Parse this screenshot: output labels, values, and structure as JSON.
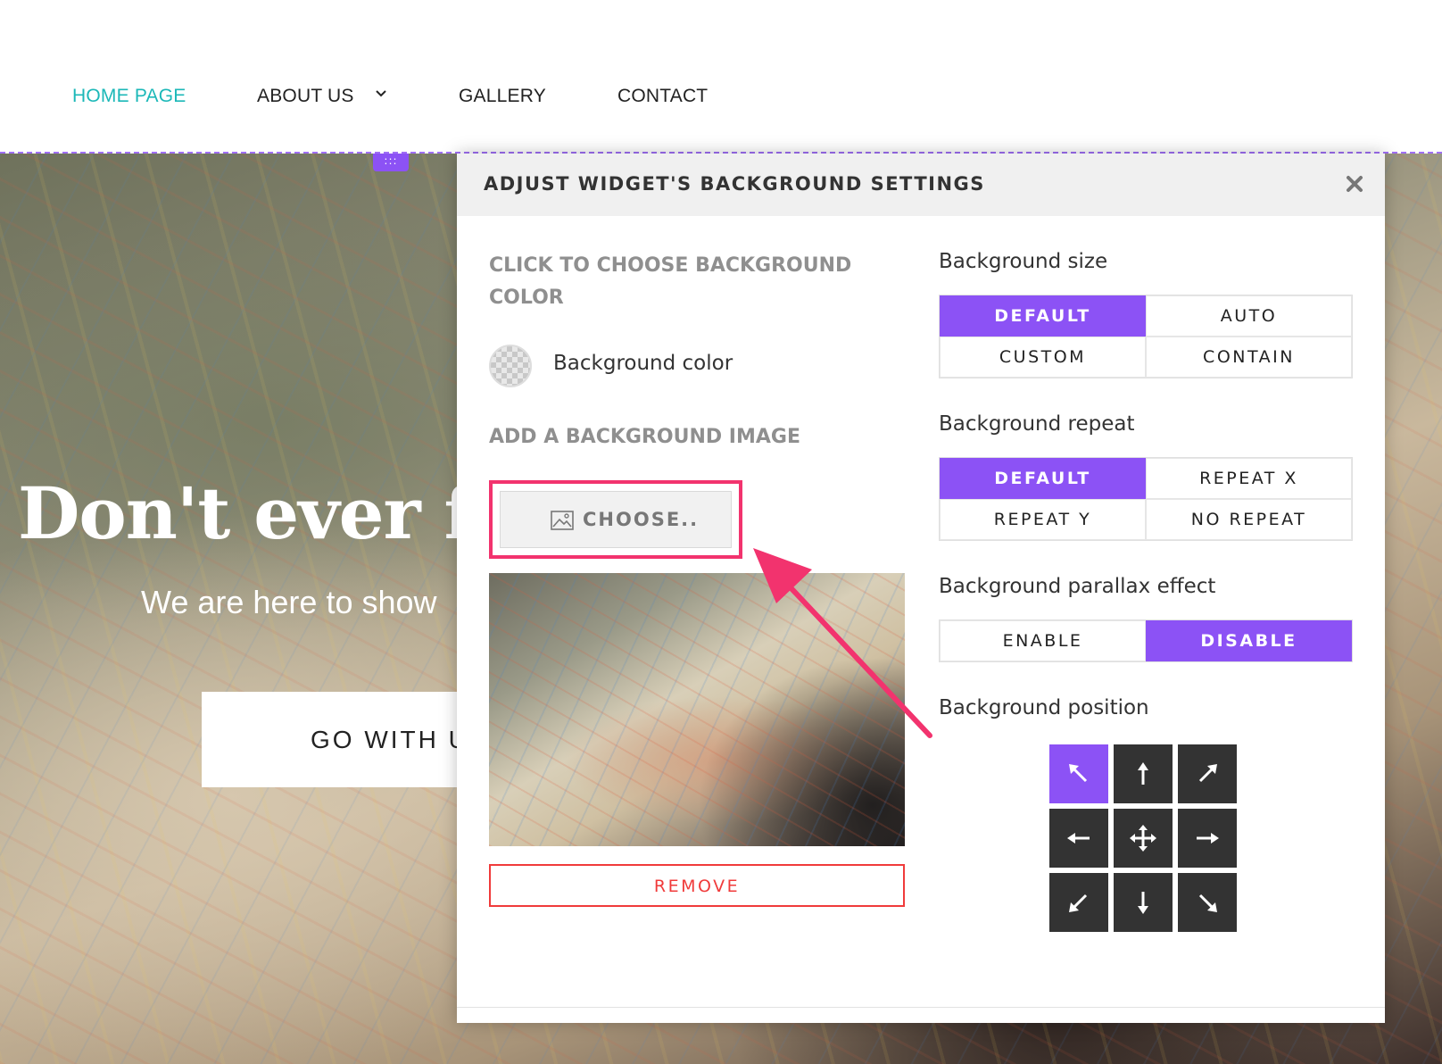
{
  "nav": {
    "items": [
      {
        "label": "HOME PAGE",
        "active": true
      },
      {
        "label": "ABOUT US",
        "has_dropdown": true
      },
      {
        "label": "GALLERY"
      },
      {
        "label": "CONTACT"
      }
    ]
  },
  "hero": {
    "title": "Don't ever f",
    "subtitle": "We are here to show",
    "button_label": "GO WITH U"
  },
  "modal": {
    "title": "ADJUST WIDGET'S BACKGROUND SETTINGS",
    "close_icon": "close-icon",
    "left": {
      "color_heading": "CLICK TO CHOOSE BACKGROUND COLOR",
      "color_label": "Background color",
      "image_heading": "ADD A BACKGROUND IMAGE",
      "choose_label": "CHOOSE..",
      "choose_icon": "image-icon",
      "remove_label": "REMOVE"
    },
    "size": {
      "label": "Background size",
      "options": [
        "DEFAULT",
        "AUTO",
        "CUSTOM",
        "CONTAIN"
      ],
      "selected": "DEFAULT"
    },
    "repeat": {
      "label": "Background repeat",
      "options": [
        "DEFAULT",
        "REPEAT X",
        "REPEAT Y",
        "NO REPEAT"
      ],
      "selected": "DEFAULT"
    },
    "parallax": {
      "label": "Background parallax effect",
      "options": [
        "ENABLE",
        "DISABLE"
      ],
      "selected": "DISABLE"
    },
    "position": {
      "label": "Background position",
      "cells": [
        "top-left",
        "top",
        "top-right",
        "left",
        "center",
        "right",
        "bottom-left",
        "bottom",
        "bottom-right"
      ],
      "selected": "top-left"
    }
  },
  "colors": {
    "accent": "#8c52f5",
    "nav_active": "#1cb8b8",
    "highlight": "#f2336e",
    "remove": "#f03b3b"
  }
}
